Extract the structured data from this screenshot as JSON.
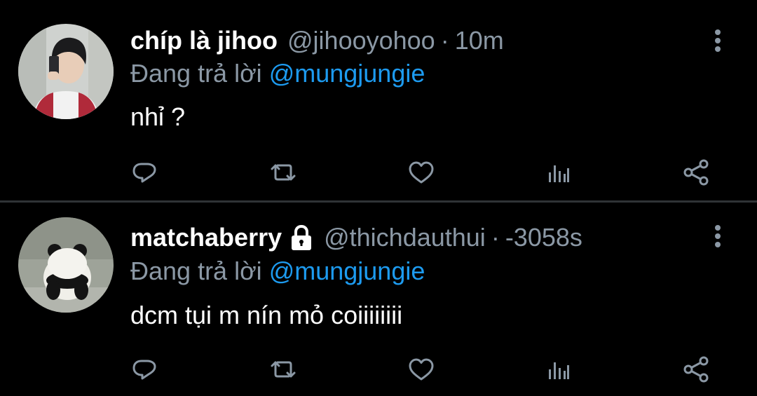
{
  "colors": {
    "background": "#000000",
    "text_primary": "#ffffff",
    "text_secondary": "#8b98a5",
    "mention": "#1d9bf0",
    "divider": "#2f3336",
    "icon": "#8b98a5"
  },
  "tweets": [
    {
      "display_name": "chíp là jihoo",
      "handle": "@jihooyohoo",
      "separator": "·",
      "time": "10m",
      "protected": false,
      "reply_prefix": "Đang trả lời ",
      "reply_to": "@mungjungie",
      "text": "nhỉ ?",
      "avatar": "selfie-avatar",
      "actions": [
        "reply-icon",
        "retweet-icon",
        "like-icon",
        "stats-icon",
        "share-icon"
      ]
    },
    {
      "display_name": "matchaberry",
      "handle": "@thichdauthui",
      "separator": "·",
      "time": "-3058s",
      "protected": true,
      "reply_prefix": "Đang trả lời ",
      "reply_to": "@mungjungie",
      "text": "dcm tụi m nín mỏ coiiiiiiii",
      "avatar": "panda-avatar",
      "actions": [
        "reply-icon",
        "retweet-icon",
        "like-icon",
        "stats-icon",
        "share-icon"
      ]
    }
  ]
}
